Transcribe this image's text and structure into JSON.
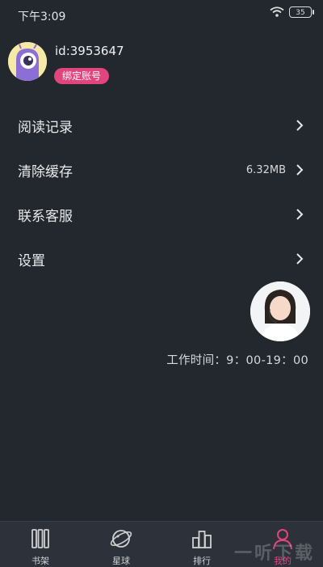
{
  "status_bar": {
    "time": "下午3:09",
    "battery": "35"
  },
  "profile": {
    "user_id": "id:3953647",
    "bind_button": "绑定账号"
  },
  "menu": [
    {
      "label": "阅读记录",
      "value": ""
    },
    {
      "label": "清除缓存",
      "value": "6.32MB"
    },
    {
      "label": "联系客服",
      "value": ""
    },
    {
      "label": "设置",
      "value": ""
    }
  ],
  "service": {
    "hours": "工作时间：9：00-19：00"
  },
  "tabs": [
    {
      "label": "书架",
      "icon": "bookshelf-icon",
      "active": false
    },
    {
      "label": "星球",
      "icon": "planet-icon",
      "active": false
    },
    {
      "label": "排行",
      "icon": "ranking-icon",
      "active": false
    },
    {
      "label": "我的",
      "icon": "user-icon",
      "active": true
    }
  ],
  "colors": {
    "background": "#23272e",
    "accent": "#e0457b",
    "tabbar": "#2c313a"
  },
  "watermark": {
    "text": "一听下载"
  }
}
